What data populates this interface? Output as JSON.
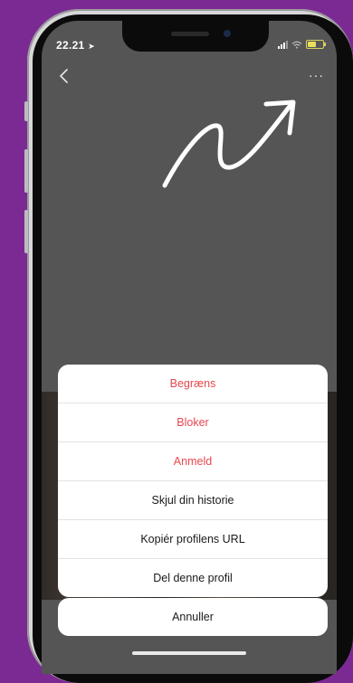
{
  "status_bar": {
    "time": "22.21"
  },
  "header": {
    "more_label": "···"
  },
  "sheet": {
    "items": [
      {
        "label": "Begræns",
        "destructive": true
      },
      {
        "label": "Bloker",
        "destructive": true
      },
      {
        "label": "Anmeld",
        "destructive": true
      },
      {
        "label": "Skjul din historie",
        "destructive": false
      },
      {
        "label": "Kopiér profilens URL",
        "destructive": false
      },
      {
        "label": "Del denne profil",
        "destructive": false
      }
    ],
    "cancel_label": "Annuller"
  },
  "colors": {
    "background": "#7b2a93",
    "destructive": "#e8474f",
    "overlay": "#555555"
  }
}
